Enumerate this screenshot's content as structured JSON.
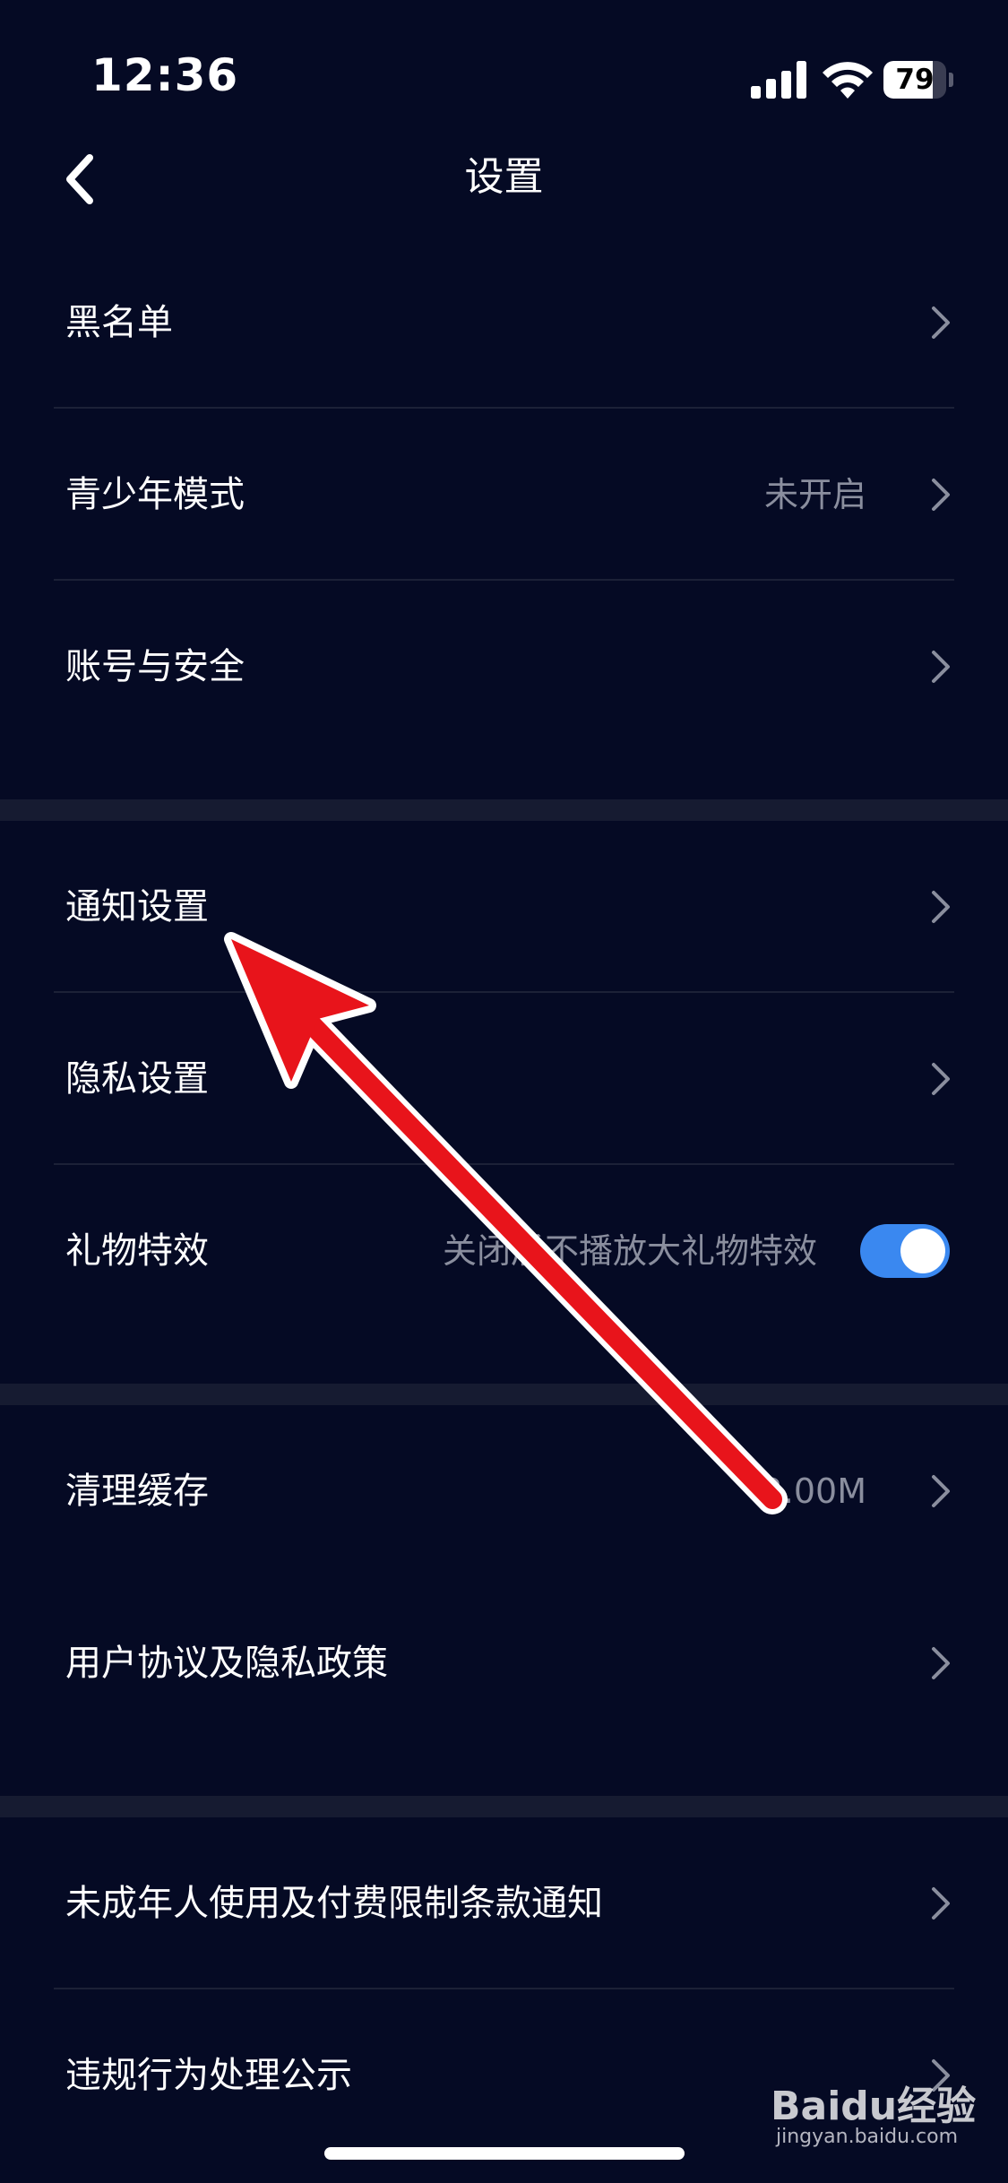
{
  "status_bar": {
    "time": "12:36",
    "battery_level": "79",
    "battery_fraction": 0.79
  },
  "nav": {
    "title": "设置",
    "back_icon": "chevron-left-icon"
  },
  "groups": [
    {
      "rows": [
        {
          "label": "黑名单",
          "value": "",
          "control": "chevron"
        },
        {
          "label": "青少年模式",
          "value": "未开启",
          "control": "chevron"
        },
        {
          "label": "账号与安全",
          "value": "",
          "control": "chevron"
        }
      ]
    },
    {
      "rows": [
        {
          "label": "通知设置",
          "value": "",
          "control": "chevron"
        },
        {
          "label": "隐私设置",
          "value": "",
          "control": "chevron"
        },
        {
          "label": "礼物特效",
          "value": "关闭后不播放大礼物特效",
          "control": "toggle",
          "toggle_on": true
        }
      ]
    },
    {
      "rows": [
        {
          "label": "清理缓存",
          "value": "2.00M",
          "control": "chevron"
        },
        {
          "label": "用户协议及隐私政策",
          "value": "",
          "control": "chevron"
        }
      ]
    },
    {
      "rows": [
        {
          "label": "未成年人使用及付费限制条款通知",
          "value": "",
          "control": "chevron"
        },
        {
          "label": "违规行为处理公示",
          "value": "",
          "control": "chevron"
        }
      ]
    }
  ],
  "colors": {
    "background": "#050a24",
    "separator": "#161b31",
    "divider": "#1c2137",
    "secondary_text": "#8a8e9e",
    "toggle_on": "#3a88f0",
    "annotation_arrow": "#e8141b"
  },
  "watermark": {
    "brand": "Baidu经验",
    "domain": "jingyan.baidu.com"
  }
}
